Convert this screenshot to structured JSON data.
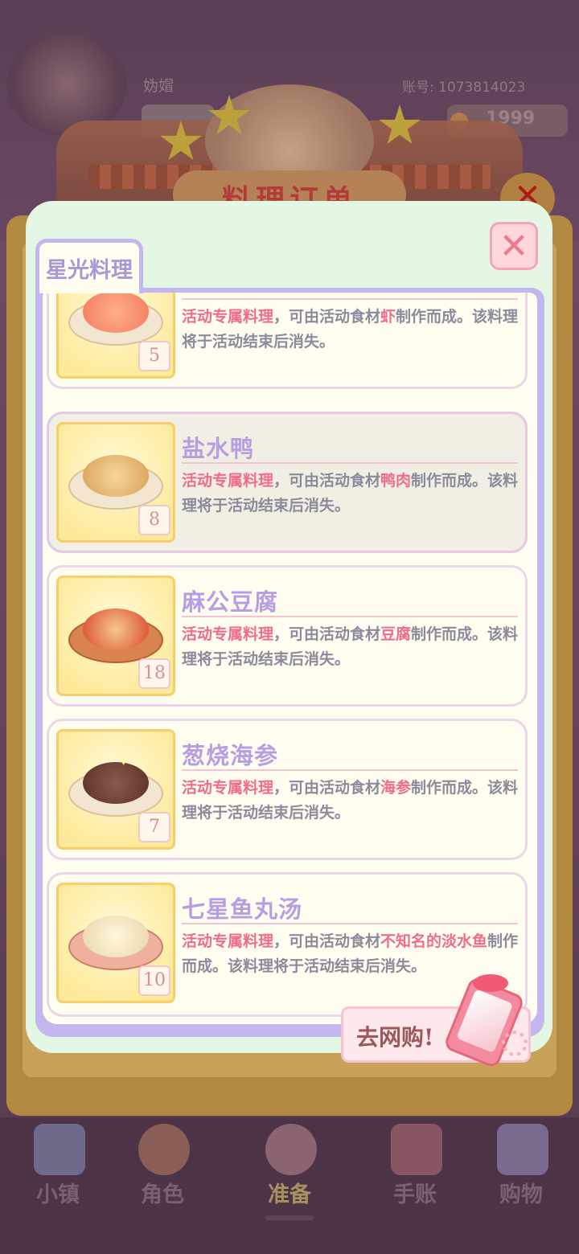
{
  "background": {
    "player_name": "妫媢",
    "account_label": "账号: 1073814023",
    "coins": "1999",
    "banner_title": "料理订单",
    "nav": [
      {
        "label": "小镇",
        "icon": "map-icon"
      },
      {
        "label": "角色",
        "icon": "character-icon"
      },
      {
        "label": "准备",
        "icon": "prepare-icon"
      },
      {
        "label": "手账",
        "icon": "journal-icon"
      },
      {
        "label": "购物",
        "icon": "shopping-bag-icon"
      }
    ]
  },
  "modal": {
    "tab_label": "星光料理",
    "close_icon": "close-icon",
    "shop_label": "去网购!",
    "colors": {
      "name": "#b79ee4",
      "highlight": "#ef6d8a",
      "desc": "#8c8a9c",
      "panel_border": "#c4b6ee"
    },
    "items": [
      {
        "name": "",
        "desc_pre": "活动专属料理",
        "desc_mid": "，可由活动食材",
        "ingredient": "虾",
        "desc_post": "制作而成。该料理将于活动结束后消失。",
        "count": "5"
      },
      {
        "name": "盐水鸭",
        "desc_pre": "活动专属料理",
        "desc_mid": "，可由活动食材",
        "ingredient": "鸭肉",
        "desc_post": "制作而成。该料理将于活动结束后消失。",
        "count": "8"
      },
      {
        "name": "麻公豆腐",
        "desc_pre": "活动专属料理",
        "desc_mid": "，可由活动食材",
        "ingredient": "豆腐",
        "desc_post": "制作而成。该料理将于活动结束后消失。",
        "count": "18"
      },
      {
        "name": "葱烧海参",
        "desc_pre": "活动专属料理",
        "desc_mid": "，可由活动食材",
        "ingredient": "海参",
        "desc_post": "制作而成。该料理将于活动结束后消失。",
        "count": "7"
      },
      {
        "name": "七星鱼丸汤",
        "desc_pre": "活动专属料理",
        "desc_mid": "，可由活动食材",
        "ingredient": "不知名的淡水鱼",
        "desc_post": "制作而成。该料理将于活动结束后消失。",
        "count": "10"
      }
    ]
  }
}
